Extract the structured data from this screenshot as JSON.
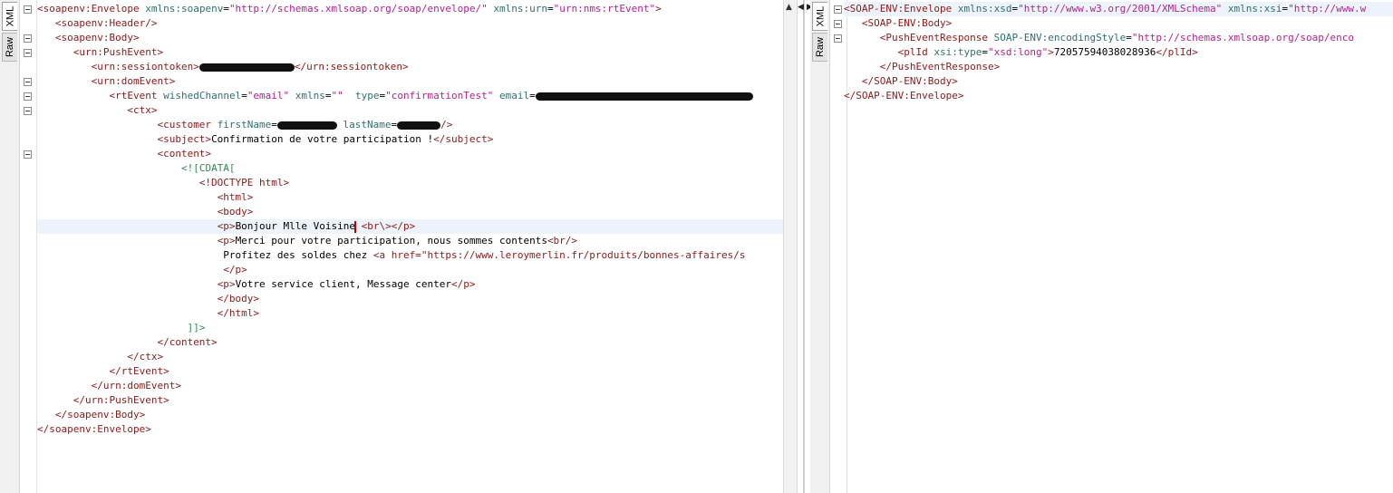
{
  "request": {
    "tabs": [
      "XML",
      "Raw"
    ],
    "lines": [
      {
        "fold": true,
        "hl": false,
        "parts": [
          [
            "tag",
            "<soapenv:Envelope "
          ],
          [
            "attr",
            "xmlns:soapenv"
          ],
          [
            "txt",
            "="
          ],
          [
            "val",
            "\"http://schemas.xmlsoap.org/soap/envelope/\""
          ],
          [
            "txt",
            " "
          ],
          [
            "attr",
            "xmlns:urn"
          ],
          [
            "txt",
            "="
          ],
          [
            "val",
            "\"urn:nms:rtEvent\""
          ],
          [
            "tag",
            ">"
          ]
        ]
      },
      {
        "fold": false,
        "hl": false,
        "parts": [
          [
            "txt",
            "   "
          ],
          [
            "tag",
            "<soapenv:Header/>"
          ]
        ]
      },
      {
        "fold": true,
        "hl": false,
        "parts": [
          [
            "txt",
            "   "
          ],
          [
            "tag",
            "<soapenv:Body>"
          ]
        ]
      },
      {
        "fold": true,
        "hl": false,
        "parts": [
          [
            "txt",
            "      "
          ],
          [
            "tag",
            "<urn:PushEvent>"
          ]
        ]
      },
      {
        "fold": false,
        "hl": false,
        "parts": [
          [
            "txt",
            "         "
          ],
          [
            "tag",
            "<urn:sessiontoken>"
          ],
          [
            "redact",
            "105"
          ],
          [
            "tag",
            "</urn:sessiontoken>"
          ]
        ]
      },
      {
        "fold": true,
        "hl": false,
        "parts": [
          [
            "txt",
            "         "
          ],
          [
            "tag",
            "<urn:domEvent>"
          ]
        ]
      },
      {
        "fold": true,
        "hl": false,
        "parts": [
          [
            "txt",
            "            "
          ],
          [
            "tag",
            "<rtEvent "
          ],
          [
            "attr",
            "wishedChannel"
          ],
          [
            "txt",
            "="
          ],
          [
            "val",
            "\"email\""
          ],
          [
            "txt",
            " "
          ],
          [
            "attr",
            "xmlns"
          ],
          [
            "txt",
            "="
          ],
          [
            "val",
            "\"\""
          ],
          [
            "txt",
            "  "
          ],
          [
            "attr",
            "type"
          ],
          [
            "txt",
            "="
          ],
          [
            "val",
            "\"confirmationTest\""
          ],
          [
            "txt",
            " "
          ],
          [
            "attr",
            "email"
          ],
          [
            "txt",
            "="
          ],
          [
            "redact",
            "240"
          ]
        ]
      },
      {
        "fold": true,
        "hl": false,
        "parts": [
          [
            "txt",
            "               "
          ],
          [
            "tag",
            "<ctx>"
          ]
        ]
      },
      {
        "fold": false,
        "hl": false,
        "parts": [
          [
            "txt",
            "                    "
          ],
          [
            "tag",
            "<customer "
          ],
          [
            "attr",
            "firstName"
          ],
          [
            "txt",
            "="
          ],
          [
            "redact",
            "66"
          ],
          [
            "txt",
            " "
          ],
          [
            "attr",
            "lastName"
          ],
          [
            "txt",
            "="
          ],
          [
            "redact",
            "48"
          ],
          [
            "tag",
            "/>"
          ]
        ]
      },
      {
        "fold": false,
        "hl": false,
        "parts": [
          [
            "txt",
            "                    "
          ],
          [
            "tag",
            "<subject>"
          ],
          [
            "txt",
            "Confirmation de votre participation !"
          ],
          [
            "tag",
            "</subject>"
          ]
        ]
      },
      {
        "fold": true,
        "hl": false,
        "parts": [
          [
            "txt",
            "                    "
          ],
          [
            "tag",
            "<content>"
          ]
        ]
      },
      {
        "fold": false,
        "hl": false,
        "parts": [
          [
            "txt",
            "                        "
          ],
          [
            "cdata",
            "<![CDATA["
          ]
        ]
      },
      {
        "fold": false,
        "hl": false,
        "parts": [
          [
            "txt",
            "                           "
          ],
          [
            "tag",
            "<!DOCTYPE html>"
          ]
        ]
      },
      {
        "fold": false,
        "hl": false,
        "parts": [
          [
            "txt",
            "                              "
          ],
          [
            "tag",
            "<html>"
          ]
        ]
      },
      {
        "fold": false,
        "hl": false,
        "parts": [
          [
            "txt",
            "                              "
          ],
          [
            "tag",
            "<body>"
          ]
        ]
      },
      {
        "fold": false,
        "hl": true,
        "parts": [
          [
            "txt",
            "                              "
          ],
          [
            "tag",
            "<p>"
          ],
          [
            "txt",
            "Bonjour Mlle Voisine"
          ],
          [
            "caret",
            ""
          ],
          [
            "txt",
            " "
          ],
          [
            "tag",
            "<br\\>"
          ],
          [
            "tag",
            "</p>"
          ]
        ]
      },
      {
        "fold": false,
        "hl": false,
        "parts": [
          [
            "txt",
            "                              "
          ],
          [
            "tag",
            "<p>"
          ],
          [
            "txt",
            "Merci pour votre participation, nous sommes contents"
          ],
          [
            "tag",
            "<br/>"
          ]
        ]
      },
      {
        "fold": false,
        "hl": false,
        "parts": [
          [
            "txt",
            "                               Profitez des soldes chez "
          ],
          [
            "tag",
            "<a href=\"https://www.leroymerlin.fr/produits/bonnes-affaires/s"
          ]
        ]
      },
      {
        "fold": false,
        "hl": false,
        "parts": [
          [
            "txt",
            "                               "
          ],
          [
            "tag",
            "</p>"
          ]
        ]
      },
      {
        "fold": false,
        "hl": false,
        "parts": [
          [
            "txt",
            "                              "
          ],
          [
            "tag",
            "<p>"
          ],
          [
            "txt",
            "Votre service client, Message center"
          ],
          [
            "tag",
            "</p>"
          ]
        ]
      },
      {
        "fold": false,
        "hl": false,
        "parts": [
          [
            "txt",
            "                              "
          ],
          [
            "tag",
            "</body>"
          ]
        ]
      },
      {
        "fold": false,
        "hl": false,
        "parts": [
          [
            "txt",
            "                              "
          ],
          [
            "tag",
            "</html>"
          ]
        ]
      },
      {
        "fold": false,
        "hl": false,
        "parts": [
          [
            "txt",
            "                         "
          ],
          [
            "cdata",
            "]]>"
          ]
        ]
      },
      {
        "fold": false,
        "hl": false,
        "parts": [
          [
            "txt",
            "                    "
          ],
          [
            "tag",
            "</content>"
          ]
        ]
      },
      {
        "fold": false,
        "hl": false,
        "parts": [
          [
            "txt",
            "               "
          ],
          [
            "tag",
            "</ctx>"
          ]
        ]
      },
      {
        "fold": false,
        "hl": false,
        "parts": [
          [
            "txt",
            "            "
          ],
          [
            "tag",
            "</rtEvent>"
          ]
        ]
      },
      {
        "fold": false,
        "hl": false,
        "parts": [
          [
            "txt",
            "         "
          ],
          [
            "tag",
            "</urn:domEvent>"
          ]
        ]
      },
      {
        "fold": false,
        "hl": false,
        "parts": [
          [
            "txt",
            "      "
          ],
          [
            "tag",
            "</urn:PushEvent>"
          ]
        ]
      },
      {
        "fold": false,
        "hl": false,
        "parts": [
          [
            "txt",
            "   "
          ],
          [
            "tag",
            "</soapenv:Body>"
          ]
        ]
      },
      {
        "fold": false,
        "hl": false,
        "parts": [
          [
            "tag",
            "</soapenv:Envelope>"
          ]
        ]
      }
    ]
  },
  "response": {
    "tabs": [
      "XML",
      "Raw"
    ],
    "lines": [
      {
        "fold": true,
        "hl": true,
        "parts": [
          [
            "tag",
            "<SOAP-ENV:Envelope "
          ],
          [
            "attr",
            "xmlns:xsd"
          ],
          [
            "txt",
            "="
          ],
          [
            "val",
            "\"http://www.w3.org/2001/XMLSchema\""
          ],
          [
            "txt",
            " "
          ],
          [
            "attr",
            "xmlns:xsi"
          ],
          [
            "txt",
            "="
          ],
          [
            "val",
            "\"http://www.w"
          ]
        ]
      },
      {
        "fold": true,
        "hl": false,
        "parts": [
          [
            "txt",
            "   "
          ],
          [
            "tag",
            "<SOAP-ENV:Body>"
          ]
        ]
      },
      {
        "fold": true,
        "hl": false,
        "parts": [
          [
            "txt",
            "      "
          ],
          [
            "tag",
            "<PushEventResponse "
          ],
          [
            "attr",
            "SOAP-ENV:encodingStyle"
          ],
          [
            "txt",
            "="
          ],
          [
            "val",
            "\"http://schemas.xmlsoap.org/soap/enco"
          ]
        ]
      },
      {
        "fold": false,
        "hl": false,
        "parts": [
          [
            "txt",
            "         "
          ],
          [
            "tag",
            "<plId "
          ],
          [
            "attr",
            "xsi:type"
          ],
          [
            "txt",
            "="
          ],
          [
            "val",
            "\"xsd:long\""
          ],
          [
            "tag",
            ">"
          ],
          [
            "txt",
            "72057594038028936"
          ],
          [
            "tag",
            "</plId>"
          ]
        ]
      },
      {
        "fold": false,
        "hl": false,
        "parts": [
          [
            "txt",
            "      "
          ],
          [
            "tag",
            "</PushEventResponse>"
          ]
        ]
      },
      {
        "fold": false,
        "hl": false,
        "parts": [
          [
            "txt",
            "   "
          ],
          [
            "tag",
            "</SOAP-ENV:Body>"
          ]
        ]
      },
      {
        "fold": false,
        "hl": false,
        "parts": [
          [
            "tag",
            "</SOAP-ENV:Envelope>"
          ]
        ]
      }
    ]
  }
}
